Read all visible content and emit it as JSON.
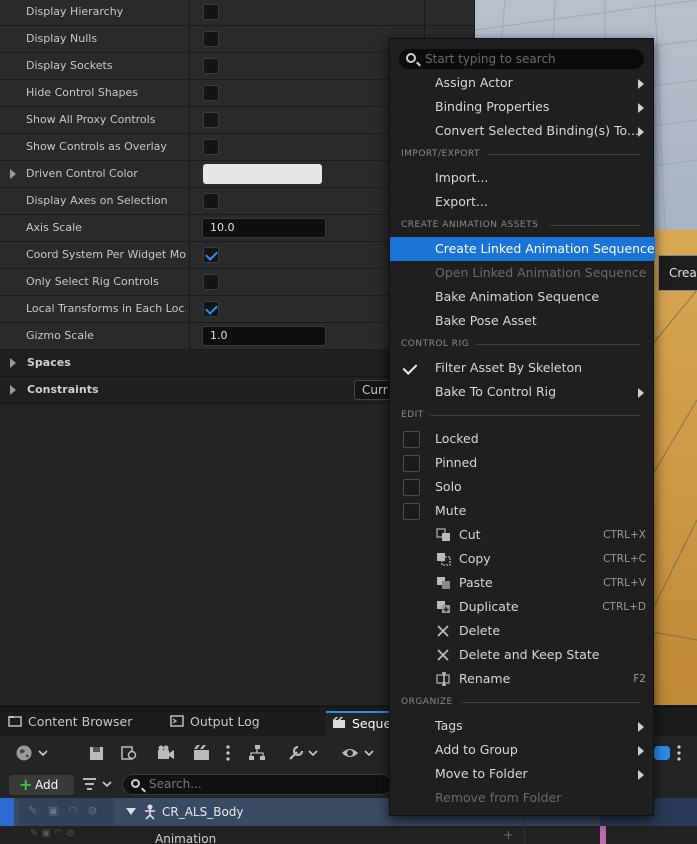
{
  "details": {
    "rows": [
      {
        "label": "Display Hierarchy",
        "type": "checkbox",
        "checked": false
      },
      {
        "label": "Display Nulls",
        "type": "checkbox",
        "checked": false
      },
      {
        "label": "Display Sockets",
        "type": "checkbox",
        "checked": false
      },
      {
        "label": "Hide Control Shapes",
        "type": "checkbox",
        "checked": false
      },
      {
        "label": "Show All Proxy Controls",
        "type": "checkbox",
        "checked": false
      },
      {
        "label": "Show Controls as Overlay",
        "type": "checkbox",
        "checked": false
      },
      {
        "label": "Driven Control Color",
        "type": "color",
        "color": "#e6e6e6"
      },
      {
        "label": "Display Axes on Selection",
        "type": "checkbox",
        "checked": false
      },
      {
        "label": "Axis Scale",
        "type": "number",
        "value": "10.0"
      },
      {
        "label": "Coord System Per Widget Mode",
        "type": "checkbox",
        "checked": true
      },
      {
        "label": "Only Select Rig Controls",
        "type": "checkbox",
        "checked": false
      },
      {
        "label": "Local Transforms in Each Loc...",
        "type": "checkbox",
        "checked": true
      },
      {
        "label": "Gizmo Scale",
        "type": "number",
        "value": "1.0"
      }
    ],
    "categories": [
      {
        "label": "Spaces"
      },
      {
        "label": "Constraints",
        "button": "Curr"
      }
    ]
  },
  "viewport": {
    "create_button": "Creat"
  },
  "tabs": [
    {
      "label": "Content Browser",
      "icon": "content-browser-icon"
    },
    {
      "label": "Output Log",
      "icon": "output-log-icon"
    },
    {
      "label": "Seque",
      "icon": "sequencer-icon",
      "active": true
    }
  ],
  "sequencer": {
    "add_label": "Add",
    "search_placeholder": "Search...",
    "track_name": "CR_ALS_Body",
    "subtrack_name": "Animation"
  },
  "menu": {
    "search_placeholder": "Start typing to search",
    "items_top": [
      {
        "label": "Assign Actor",
        "submenu": true
      },
      {
        "label": "Binding Properties",
        "submenu": true
      },
      {
        "label": "Convert Selected Binding(s) To...",
        "submenu": true
      }
    ],
    "sections": {
      "import_export": "IMPORT/EXPORT",
      "create_animation_assets": "CREATE ANIMATION ASSETS",
      "control_rig": "CONTROL RIG",
      "edit": "EDIT",
      "organize": "ORGANIZE"
    },
    "import_export": [
      {
        "label": "Import..."
      },
      {
        "label": "Export..."
      }
    ],
    "create_animation_assets": [
      {
        "label": "Create Linked Animation Sequence",
        "highlighted": true
      },
      {
        "label": "Open Linked Animation Sequence",
        "disabled": true
      },
      {
        "label": "Bake Animation Sequence"
      },
      {
        "label": "Bake Pose Asset"
      }
    ],
    "control_rig": [
      {
        "label": "Filter Asset By Skeleton",
        "checked": true
      },
      {
        "label": "Bake To Control Rig",
        "submenu": true
      }
    ],
    "edit_toggles": [
      {
        "label": "Locked"
      },
      {
        "label": "Pinned"
      },
      {
        "label": "Solo"
      },
      {
        "label": "Mute"
      }
    ],
    "edit_actions": [
      {
        "label": "Cut",
        "shortcut": "CTRL+X",
        "icon": "cut-icon"
      },
      {
        "label": "Copy",
        "shortcut": "CTRL+C",
        "icon": "copy-icon"
      },
      {
        "label": "Paste",
        "shortcut": "CTRL+V",
        "icon": "paste-icon"
      },
      {
        "label": "Duplicate",
        "shortcut": "CTRL+D",
        "icon": "duplicate-icon"
      },
      {
        "label": "Delete",
        "shortcut": "",
        "icon": "delete-icon"
      },
      {
        "label": "Delete and Keep State",
        "shortcut": "",
        "icon": "delete-keep-state-icon"
      },
      {
        "label": "Rename",
        "shortcut": "F2",
        "icon": "rename-icon"
      }
    ],
    "organize": [
      {
        "label": "Tags",
        "submenu": true
      },
      {
        "label": "Add to Group",
        "submenu": true
      },
      {
        "label": "Move to Folder",
        "submenu": true
      },
      {
        "label": "Remove from Folder",
        "disabled": true
      }
    ]
  },
  "colors": {
    "highlight": "#1a73d6",
    "checkbox_check": "#2d8cf0",
    "add_plus": "#38c048"
  }
}
